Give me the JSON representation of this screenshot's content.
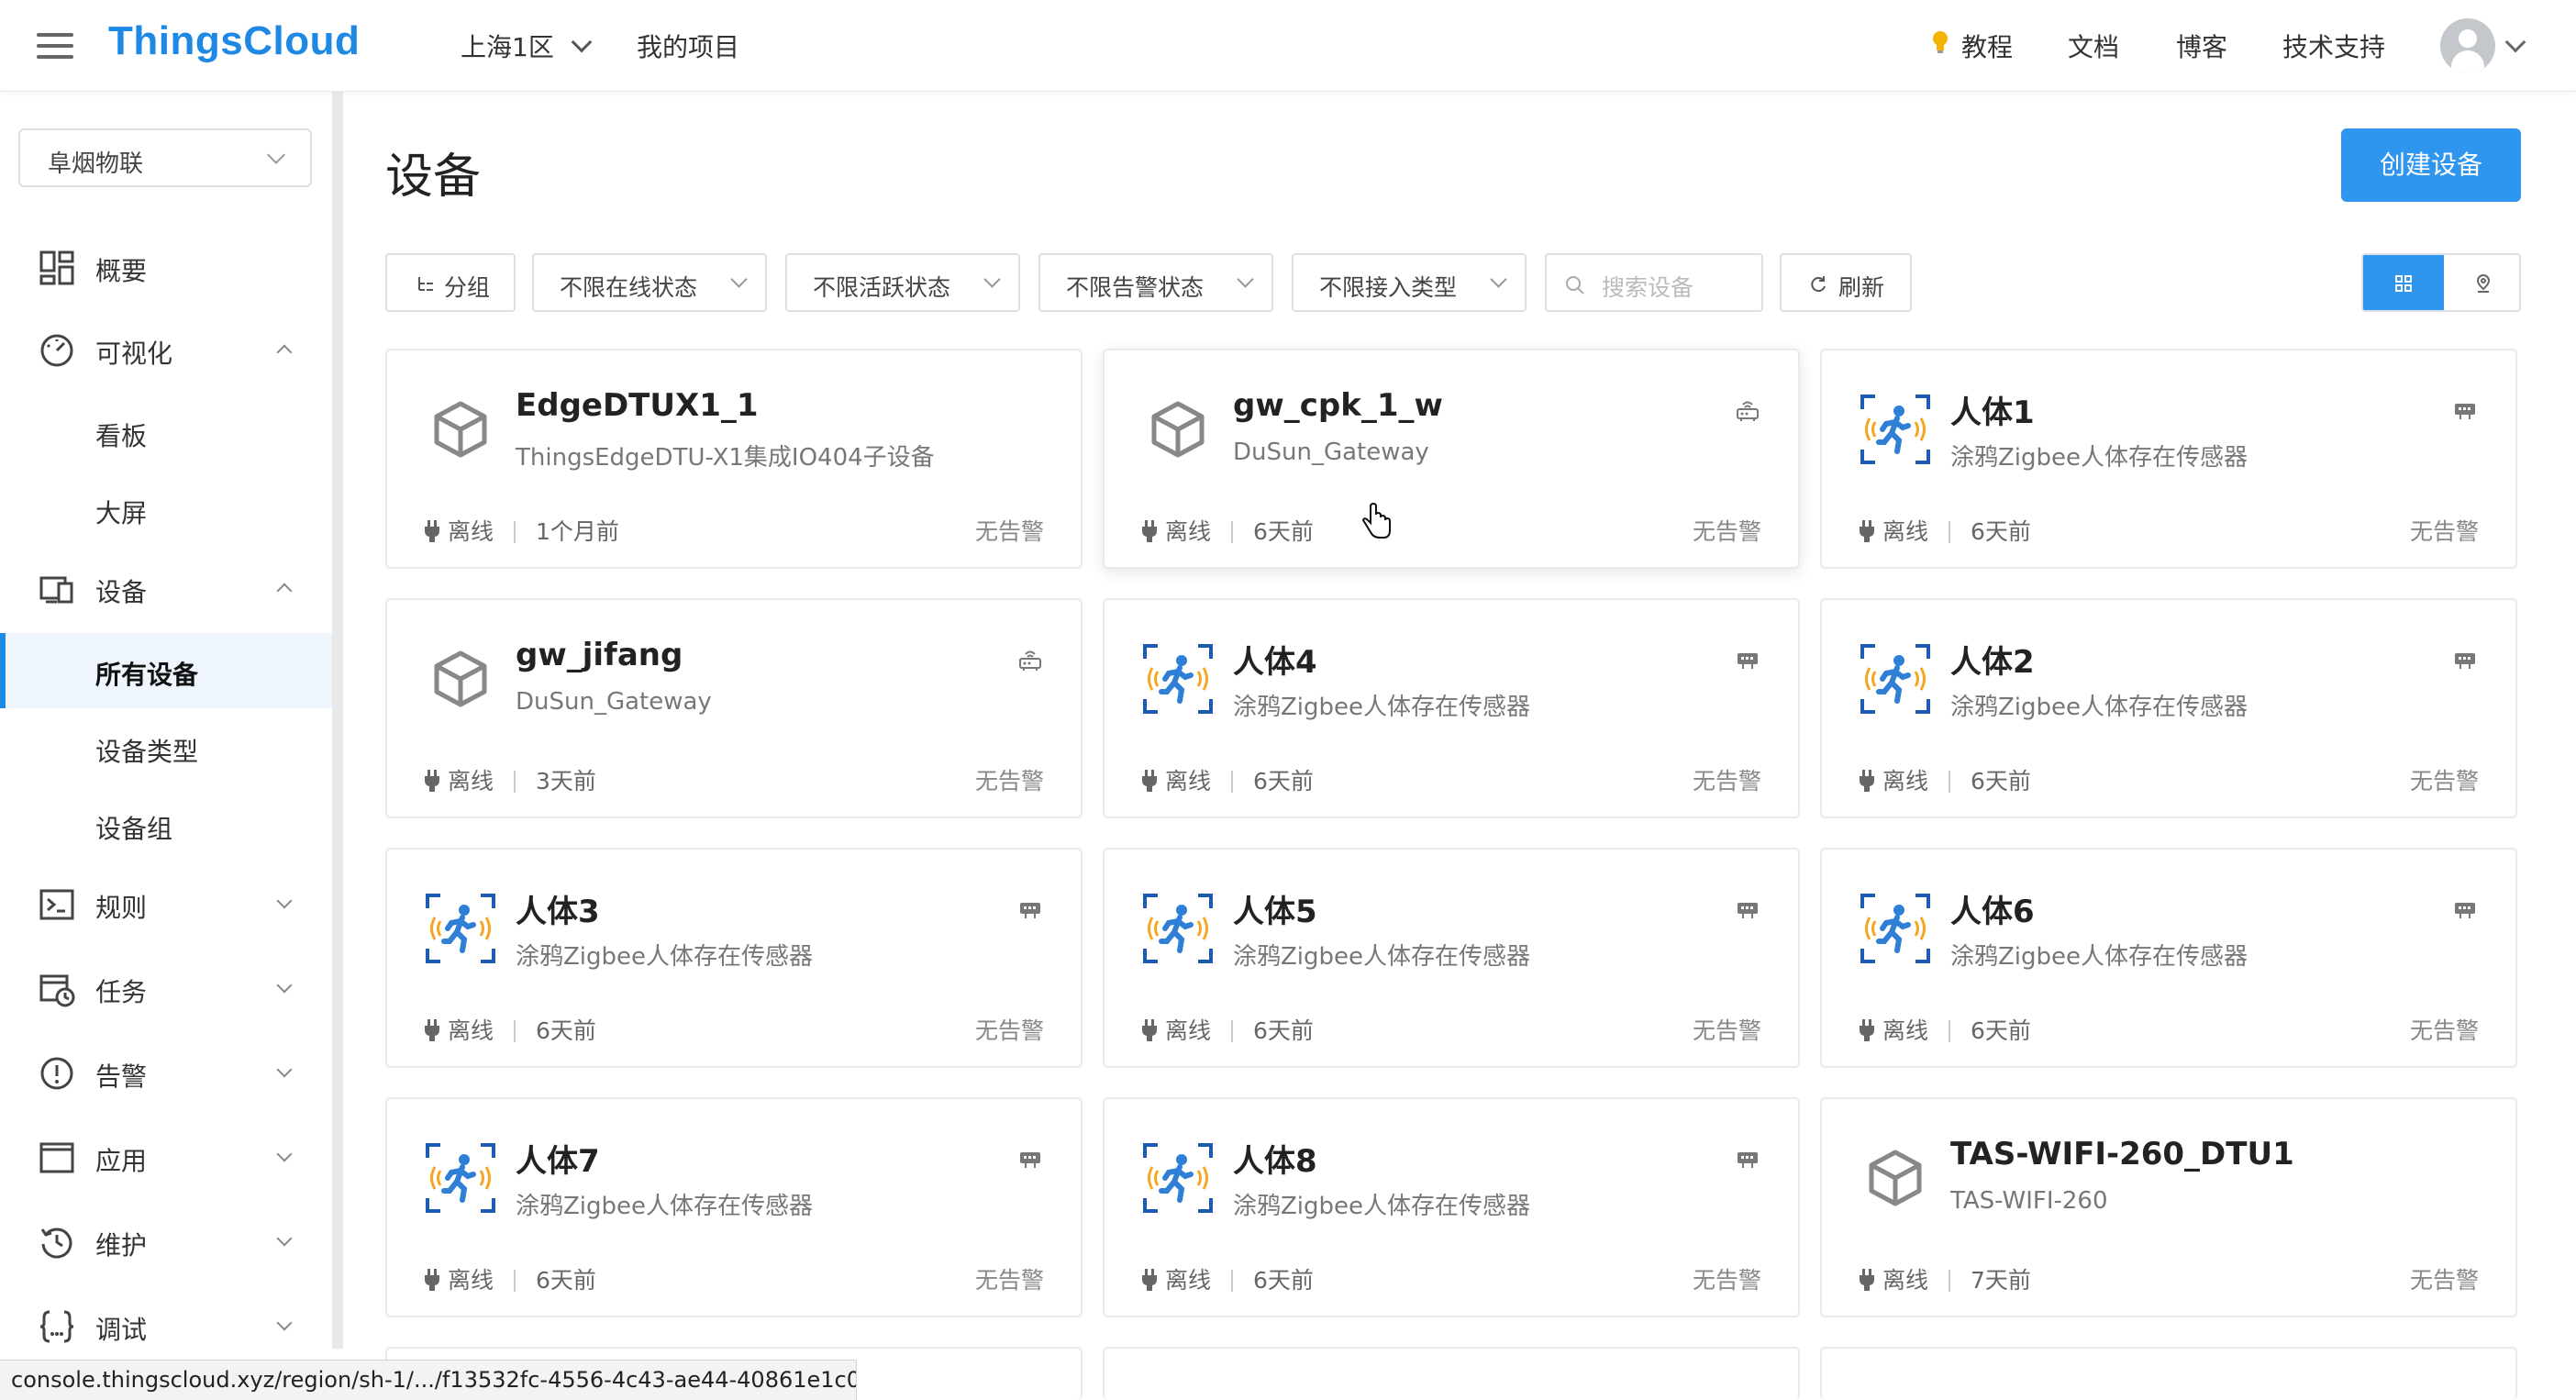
{
  "header": {
    "logo": "ThingsCloud",
    "region": "上海1区",
    "my_project": "我的项目",
    "nav": {
      "tutorial": "教程",
      "docs": "文档",
      "blog": "博客",
      "support": "技术支持"
    }
  },
  "sidebar": {
    "project": "阜烟物联",
    "items": {
      "overview": "概要",
      "visualization": "可视化",
      "board": "看板",
      "bigscreen": "大屏",
      "devices": "设备",
      "all_devices": "所有设备",
      "device_types": "设备类型",
      "device_groups": "设备组",
      "rules": "规则",
      "tasks": "任务",
      "alarms": "告警",
      "apps": "应用",
      "maintenance": "维护",
      "debug": "调试"
    }
  },
  "main": {
    "title": "设备",
    "create_button": "创建设备",
    "filters": {
      "group": "分组",
      "online": "不限在线状态",
      "active": "不限活跃状态",
      "alarm": "不限告警状态",
      "access": "不限接入类型",
      "search_placeholder": "搜索设备",
      "refresh": "刷新"
    },
    "devices": [
      {
        "name": "EdgeDTUX1_1",
        "type": "ThingsEdgeDTU-X1集成IO404子设备",
        "status": "离线",
        "time": "1个月前",
        "alarm": "无告警",
        "icon": "cube-icon",
        "conn": ""
      },
      {
        "name": "gw_cpk_1_w",
        "type": "DuSun_Gateway",
        "status": "离线",
        "time": "6天前",
        "alarm": "无告警",
        "icon": "cube-icon",
        "conn": "router-icon"
      },
      {
        "name": "人体1",
        "type": "涂鸦Zigbee人体存在传感器",
        "status": "离线",
        "time": "6天前",
        "alarm": "无告警",
        "icon": "motion-sensor-icon",
        "conn": "subdevice-icon"
      },
      {
        "name": "gw_jifang",
        "type": "DuSun_Gateway",
        "status": "离线",
        "time": "3天前",
        "alarm": "无告警",
        "icon": "cube-icon",
        "conn": "router-icon"
      },
      {
        "name": "人体4",
        "type": "涂鸦Zigbee人体存在传感器",
        "status": "离线",
        "time": "6天前",
        "alarm": "无告警",
        "icon": "motion-sensor-icon",
        "conn": "subdevice-icon"
      },
      {
        "name": "人体2",
        "type": "涂鸦Zigbee人体存在传感器",
        "status": "离线",
        "time": "6天前",
        "alarm": "无告警",
        "icon": "motion-sensor-icon",
        "conn": "subdevice-icon"
      },
      {
        "name": "人体3",
        "type": "涂鸦Zigbee人体存在传感器",
        "status": "离线",
        "time": "6天前",
        "alarm": "无告警",
        "icon": "motion-sensor-icon",
        "conn": "subdevice-icon"
      },
      {
        "name": "人体5",
        "type": "涂鸦Zigbee人体存在传感器",
        "status": "离线",
        "time": "6天前",
        "alarm": "无告警",
        "icon": "motion-sensor-icon",
        "conn": "subdevice-icon"
      },
      {
        "name": "人体6",
        "type": "涂鸦Zigbee人体存在传感器",
        "status": "离线",
        "time": "6天前",
        "alarm": "无告警",
        "icon": "motion-sensor-icon",
        "conn": "subdevice-icon"
      },
      {
        "name": "人体7",
        "type": "涂鸦Zigbee人体存在传感器",
        "status": "离线",
        "time": "6天前",
        "alarm": "无告警",
        "icon": "motion-sensor-icon",
        "conn": "subdevice-icon"
      },
      {
        "name": "人体8",
        "type": "涂鸦Zigbee人体存在传感器",
        "status": "离线",
        "time": "6天前",
        "alarm": "无告警",
        "icon": "motion-sensor-icon",
        "conn": "subdevice-icon"
      },
      {
        "name": "TAS-WIFI-260_DTU1",
        "type": "TAS-WIFI-260",
        "status": "离线",
        "time": "7天前",
        "alarm": "无告警",
        "icon": "cube-icon",
        "conn": ""
      }
    ]
  },
  "statusbar": {
    "url": "console.thingscloud.xyz/region/sh-1/.../f13532fc-4556-4c43-ae44-40861e1c0..."
  },
  "colors": {
    "brand": "#1e88e5",
    "primary_button": "#2f96ef",
    "active_bg": "#eef5fd"
  }
}
